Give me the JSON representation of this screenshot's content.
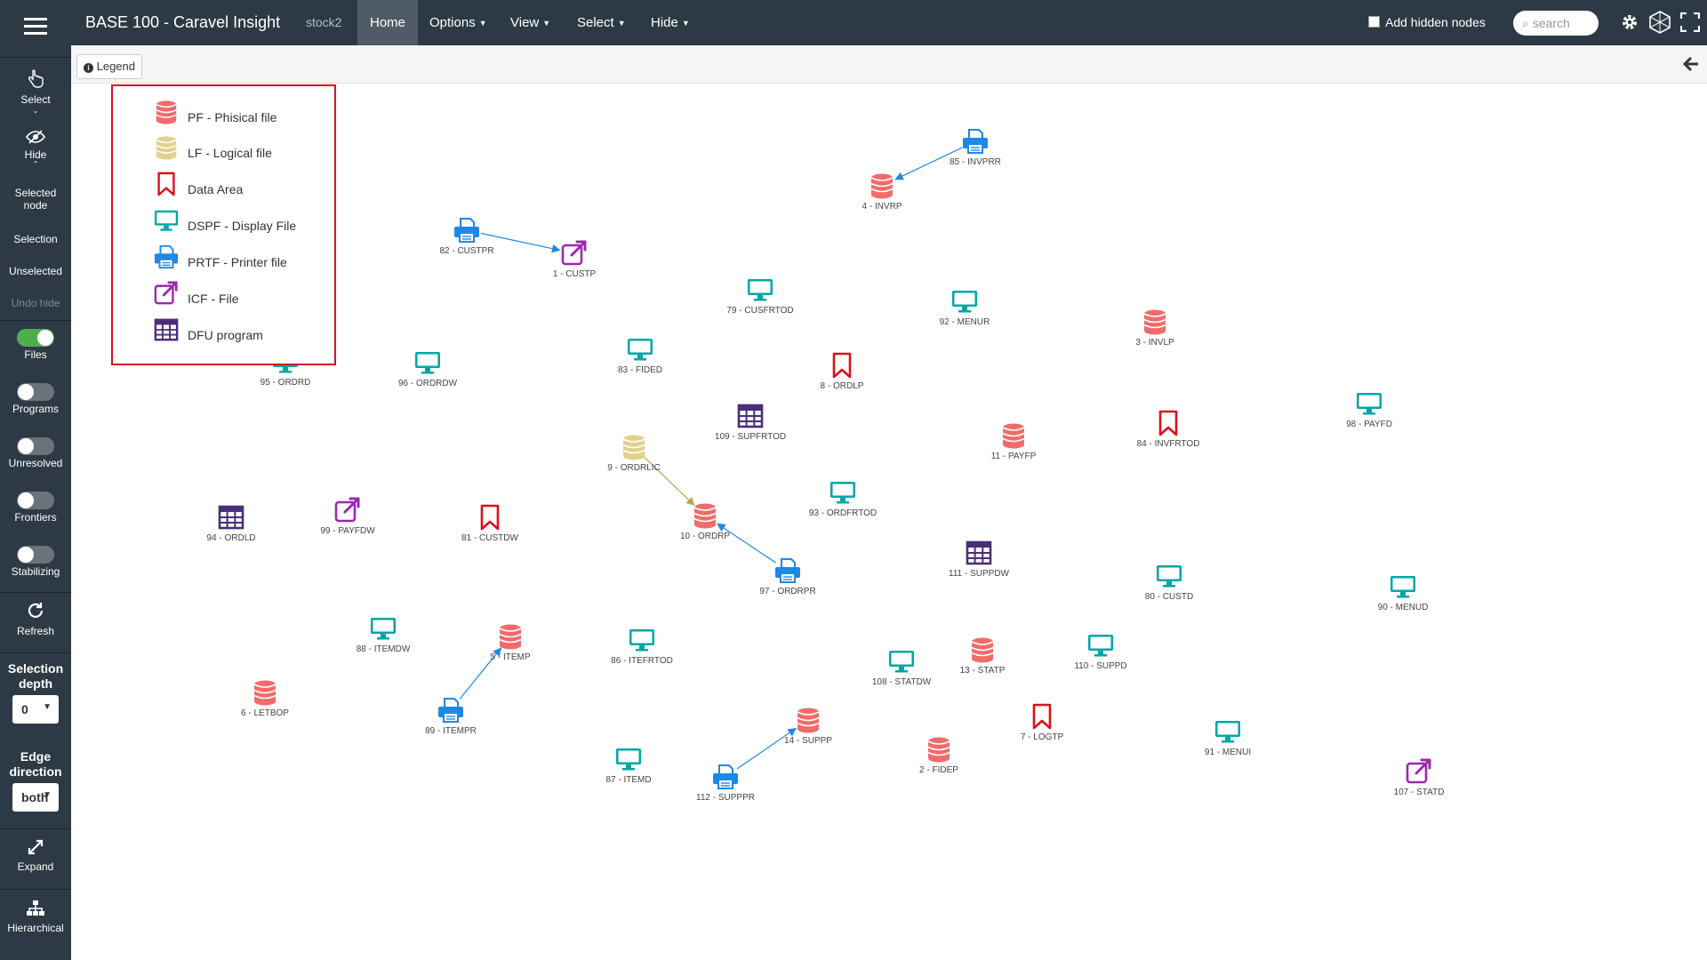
{
  "app": {
    "title": "BASE 100 - Caravel Insight",
    "project": "stock2"
  },
  "menu": {
    "home": "Home",
    "options": "Options",
    "view": "View",
    "select": "Select",
    "hide": "Hide"
  },
  "toolbar_right": {
    "add_hidden_nodes": "Add hidden nodes",
    "add_hidden_nodes_checked": false,
    "search_placeholder": "search",
    "icons": [
      "gear-icon",
      "caravel-logo-icon",
      "fullscreen-icon"
    ]
  },
  "legend_button": "Legend",
  "legend": [
    {
      "key": "pf",
      "label": "PF - Phisical file",
      "icon": "database-icon",
      "color": "#f26b6b"
    },
    {
      "key": "lf",
      "label": "LF - Logical file",
      "icon": "database-icon",
      "color": "#e0d18c"
    },
    {
      "key": "da",
      "label": "Data Area",
      "icon": "bookmark-icon",
      "color": "#d9121a"
    },
    {
      "key": "dspf",
      "label": "DSPF - Display File",
      "icon": "monitor-icon",
      "color": "#00a6a6"
    },
    {
      "key": "prtf",
      "label": "PRTF - Printer file",
      "icon": "printer-icon",
      "color": "#1e88e5"
    },
    {
      "key": "icf",
      "label": "ICF - File",
      "icon": "external-link-icon",
      "color": "#9c27b0"
    },
    {
      "key": "dfu",
      "label": "DFU program",
      "icon": "table-grid-icon",
      "color": "#4a2e7a"
    }
  ],
  "sidebar": {
    "select": "Select",
    "hide": "Hide",
    "selected_node": "Selected node",
    "selection": "Selection",
    "unselected": "Unselected",
    "undo_hide": "Undo hide",
    "toggles": [
      {
        "label": "Files",
        "on": true
      },
      {
        "label": "Programs",
        "on": false
      },
      {
        "label": "Unresolved",
        "on": false
      },
      {
        "label": "Frontiers",
        "on": false
      },
      {
        "label": "Stabilizing",
        "on": false
      }
    ],
    "refresh": "Refresh",
    "selection_depth_label": "Selection depth",
    "selection_depth_value": "0",
    "edge_direction_label": "Edge direction",
    "edge_direction_value": "both",
    "expand": "Expand",
    "hierarchical": "Hierarchical"
  },
  "nodes": [
    {
      "id": "85",
      "label": "85 - INVPRR",
      "type": "prtf"
    },
    {
      "id": "4",
      "label": "4 - INVRP",
      "type": "pf"
    },
    {
      "id": "82",
      "label": "82 - CUSTPR",
      "type": "prtf"
    },
    {
      "id": "1",
      "label": "1 - CUSTP",
      "type": "icf"
    },
    {
      "id": "79",
      "label": "79 - CUSFRTOD",
      "type": "dspf"
    },
    {
      "id": "92",
      "label": "92 - MENUR",
      "type": "dspf"
    },
    {
      "id": "3",
      "label": "3 - INVLP",
      "type": "pf"
    },
    {
      "id": "95",
      "label": "95 - ORDRD",
      "type": "dspf"
    },
    {
      "id": "96",
      "label": "96 - ORDRDW",
      "type": "dspf"
    },
    {
      "id": "83",
      "label": "83 - FIDED",
      "type": "dspf"
    },
    {
      "id": "8",
      "label": "8 - ORDLP",
      "type": "da"
    },
    {
      "id": "98",
      "label": "98 - PAYFD",
      "type": "dspf"
    },
    {
      "id": "109",
      "label": "109 - SUPFRTOD",
      "type": "dfu"
    },
    {
      "id": "11",
      "label": "11 - PAYFP",
      "type": "pf"
    },
    {
      "id": "84",
      "label": "84 - INVFRTOD",
      "type": "da"
    },
    {
      "id": "9",
      "label": "9 - ORDRLIC",
      "type": "lf"
    },
    {
      "id": "93",
      "label": "93 - ORDFRTOD",
      "type": "dspf"
    },
    {
      "id": "94",
      "label": "94 - ORDLD",
      "type": "dfu"
    },
    {
      "id": "99",
      "label": "99 - PAYFDW",
      "type": "icf"
    },
    {
      "id": "81",
      "label": "81 - CUSTDW",
      "type": "da"
    },
    {
      "id": "10",
      "label": "10 - ORDRP",
      "type": "pf"
    },
    {
      "id": "97",
      "label": "97 - ORDRPR",
      "type": "prtf"
    },
    {
      "id": "111",
      "label": "111 - SUPPDW",
      "type": "dfu"
    },
    {
      "id": "80",
      "label": "80 - CUSTD",
      "type": "dspf"
    },
    {
      "id": "90",
      "label": "90 - MENUD",
      "type": "dspf"
    },
    {
      "id": "88",
      "label": "88 - ITEMDW",
      "type": "dspf"
    },
    {
      "id": "5",
      "label": "5 - ITEMP",
      "type": "pf"
    },
    {
      "id": "86",
      "label": "86 - ITEFRTOD",
      "type": "dspf"
    },
    {
      "id": "108",
      "label": "108 - STATDW",
      "type": "dspf"
    },
    {
      "id": "13",
      "label": "13 - STATP",
      "type": "pf"
    },
    {
      "id": "110",
      "label": "110 - SUPPD",
      "type": "dspf"
    },
    {
      "id": "6",
      "label": "6 - LETBOP",
      "type": "pf"
    },
    {
      "id": "89",
      "label": "89 - ITEMPR",
      "type": "prtf"
    },
    {
      "id": "14",
      "label": "14 - SUPPP",
      "type": "pf"
    },
    {
      "id": "7",
      "label": "7 - LOGTP",
      "type": "da"
    },
    {
      "id": "91",
      "label": "91 - MENUI",
      "type": "dspf"
    },
    {
      "id": "87",
      "label": "87 - ITEMD",
      "type": "dspf"
    },
    {
      "id": "2",
      "label": "2 - FIDEP",
      "type": "pf"
    },
    {
      "id": "112",
      "label": "112 - SUPPPR",
      "type": "prtf"
    },
    {
      "id": "107",
      "label": "107 - STATD",
      "type": "icf"
    }
  ],
  "edges": [
    {
      "from": "85",
      "to": "4",
      "color": "#1e88e5"
    },
    {
      "from": "82",
      "to": "1",
      "color": "#1e88e5"
    },
    {
      "from": "9",
      "to": "10",
      "color": "#b5a94a"
    },
    {
      "from": "97",
      "to": "10",
      "color": "#1e88e5"
    },
    {
      "from": "89",
      "to": "5",
      "color": "#1e88e5"
    },
    {
      "from": "112",
      "to": "14",
      "color": "#1e88e5"
    }
  ]
}
